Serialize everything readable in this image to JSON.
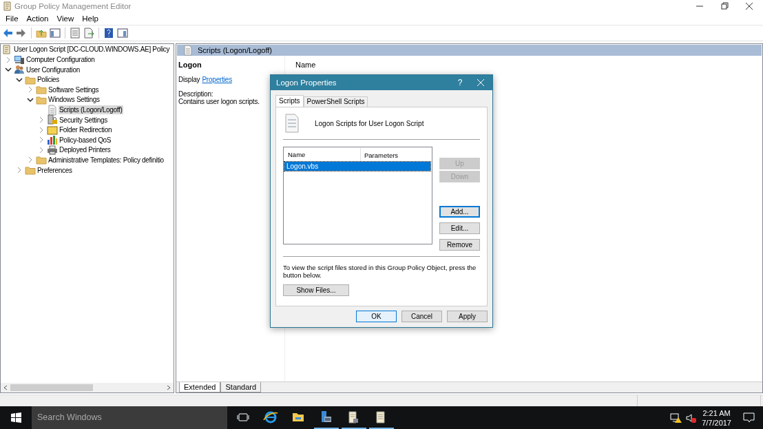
{
  "window": {
    "title": "Group Policy Management Editor"
  },
  "menu": [
    "File",
    "Action",
    "View",
    "Help"
  ],
  "tree": [
    {
      "label": "User Logon Script [DC-CLOUD.WINDOWS.AE] Policy",
      "kind": "policy",
      "selected": false,
      "children": [
        {
          "label": "Computer Configuration",
          "kind": "computer",
          "expanded": false,
          "selected": false
        },
        {
          "label": "User Configuration",
          "kind": "user",
          "expanded": true,
          "selected": false,
          "children": [
            {
              "label": "Policies",
              "kind": "folder",
              "expanded": true,
              "selected": false,
              "children": [
                {
                  "label": "Software Settings",
                  "kind": "folder",
                  "expanded": false,
                  "selected": false
                },
                {
                  "label": "Windows Settings",
                  "kind": "folder",
                  "expanded": true,
                  "selected": false,
                  "children": [
                    {
                      "label": "Scripts (Logon/Logoff)",
                      "kind": "script",
                      "expanded": false,
                      "leaf": true,
                      "selected": true
                    },
                    {
                      "label": "Security Settings",
                      "kind": "security",
                      "expanded": false,
                      "selected": false
                    },
                    {
                      "label": "Folder Redirection",
                      "kind": "yellowfolder",
                      "expanded": false,
                      "selected": false
                    },
                    {
                      "label": "Policy-based QoS",
                      "kind": "chart",
                      "expanded": false,
                      "selected": false
                    },
                    {
                      "label": "Deployed Printers",
                      "kind": "printer",
                      "expanded": false,
                      "selected": false
                    }
                  ]
                },
                {
                  "label": "Administrative Templates: Policy definitio",
                  "kind": "folder",
                  "expanded": false,
                  "selected": false
                }
              ]
            },
            {
              "label": "Preferences",
              "kind": "folder",
              "expanded": false,
              "selected": false
            }
          ]
        }
      ]
    }
  ],
  "details": {
    "header": "Scripts (Logon/Logoff)",
    "heading": "Logon",
    "display_label": "Display",
    "link": "Properties",
    "description_label": "Description:",
    "description": "Contains user logon scripts.",
    "column": "Name"
  },
  "view_tabs": [
    {
      "label": "Extended",
      "selected": true
    },
    {
      "label": "Standard",
      "selected": false
    }
  ],
  "dialog": {
    "title": "Logon Properties",
    "help": "?",
    "tabs": [
      {
        "label": "Scripts",
        "selected": true
      },
      {
        "label": "PowerShell Scripts",
        "selected": false
      }
    ],
    "heading": "Logon Scripts for User Logon Script",
    "columns": [
      "Name",
      "Parameters"
    ],
    "rows": [
      {
        "name": "Logon.vbs",
        "selected": true
      }
    ],
    "side_buttons": [
      {
        "label": "Up",
        "disabled": true,
        "focused": false
      },
      {
        "label": "Down",
        "disabled": true,
        "focused": false
      },
      {
        "label": "Add...",
        "disabled": false,
        "focused": true
      },
      {
        "label": "Edit...",
        "disabled": false,
        "focused": false
      },
      {
        "label": "Remove",
        "disabled": false,
        "focused": false
      }
    ],
    "note": "To view the script files stored in this Group Policy Object, press the button below.",
    "show_files": "Show Files...",
    "buttons": [
      {
        "label": "OK",
        "default": true
      },
      {
        "label": "Cancel",
        "default": false
      },
      {
        "label": "Apply",
        "default": false
      }
    ]
  },
  "taskbar": {
    "search_placeholder": "Search Windows",
    "apps": [
      {
        "kind": "taskview",
        "running": false
      },
      {
        "kind": "ie",
        "running": false
      },
      {
        "kind": "explorer",
        "running": false
      },
      {
        "kind": "server",
        "running": true
      },
      {
        "kind": "scriptdoc",
        "running": true
      },
      {
        "kind": "scroll",
        "running": true
      }
    ],
    "time": "2:21 AM",
    "date": "7/7/2017"
  }
}
